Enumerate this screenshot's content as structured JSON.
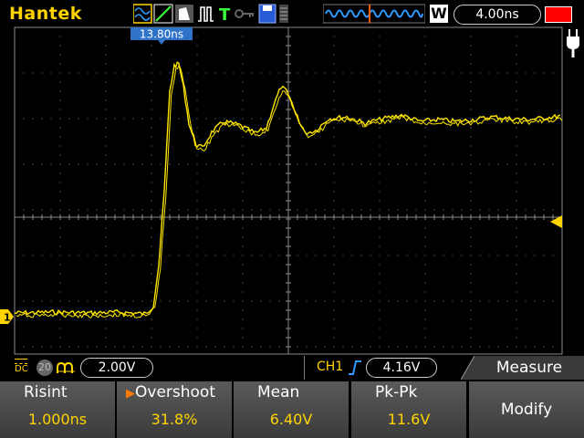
{
  "header": {
    "brand": "Hantek",
    "timebase": "4.00ns",
    "w_label": "W"
  },
  "cursor_label": "13.80ns",
  "channel": {
    "coupling": "DC",
    "bw_label": "20",
    "volts_div": "2.00V",
    "trigger_source": "CH1",
    "trigger_level": "4.16V",
    "marker": "1"
  },
  "menu": {
    "title": "Measure",
    "modify_label": "Modify"
  },
  "measurements": [
    {
      "label": "Risint",
      "value": "1.000ns",
      "selected": false
    },
    {
      "label": "Overshoot",
      "value": "31.8%",
      "selected": true
    },
    {
      "label": "Mean",
      "value": "6.40V",
      "selected": false
    },
    {
      "label": "Pk-Pk",
      "value": "11.6V",
      "selected": false
    }
  ],
  "colors": {
    "trace": "#ffe600",
    "grid": "#8a8a8a",
    "accent": "#ffd400",
    "battery": "#ff0000",
    "cursor": "#2f73c8"
  }
}
